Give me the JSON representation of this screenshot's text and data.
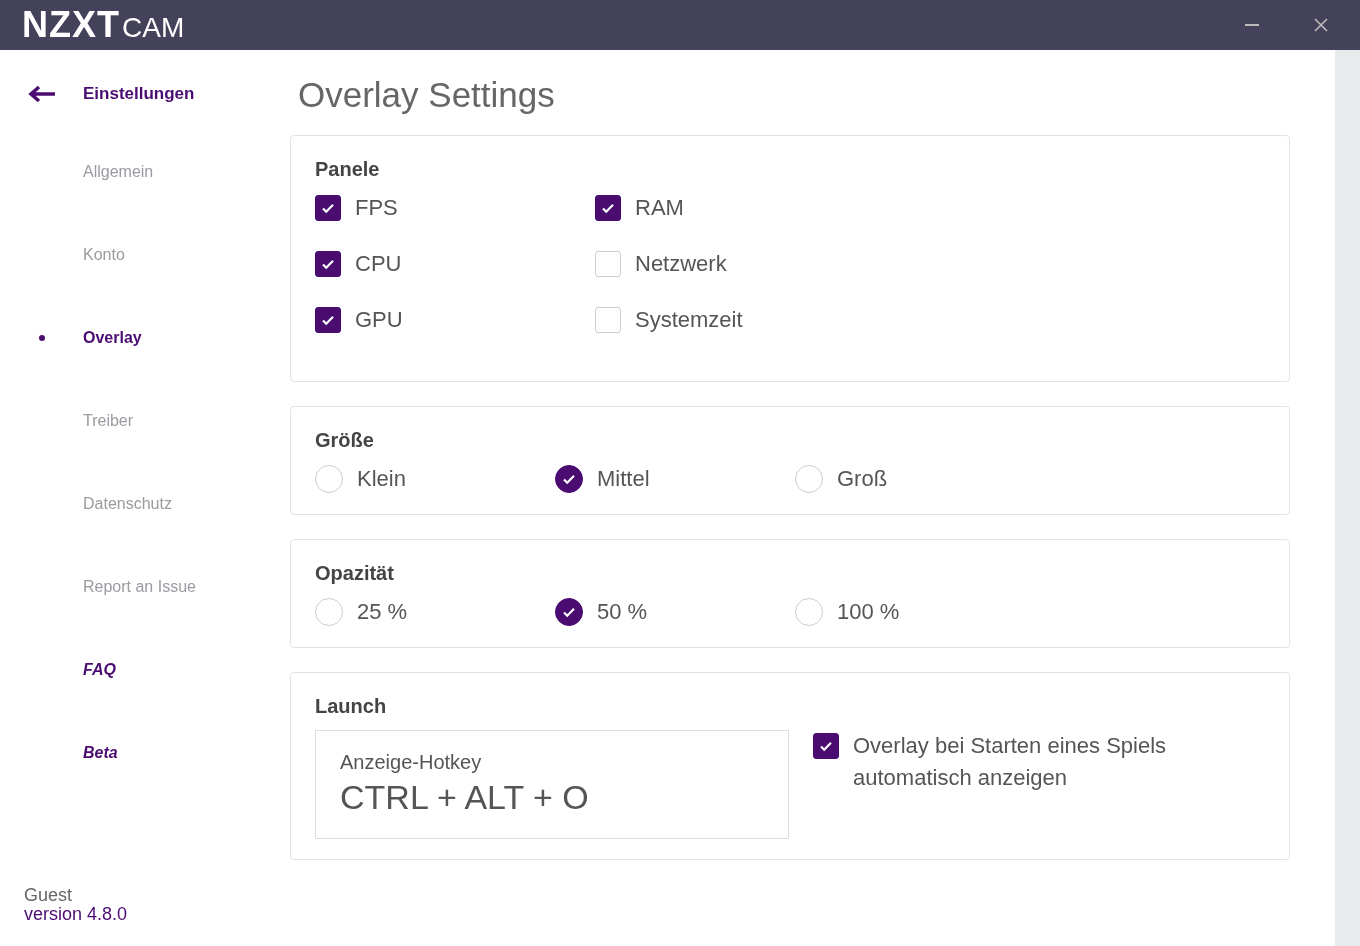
{
  "titlebar": {
    "brand": "NZXT",
    "product": "CAM"
  },
  "sidebar": {
    "back": {
      "label": "Einstellungen"
    },
    "items": [
      {
        "label": "Allgemein",
        "kind": "page",
        "selected": false
      },
      {
        "label": "Konto",
        "kind": "page",
        "selected": false
      },
      {
        "label": "Overlay",
        "kind": "page",
        "selected": true
      },
      {
        "label": "Treiber",
        "kind": "page",
        "selected": false
      },
      {
        "label": "Datenschutz",
        "kind": "page",
        "selected": false
      },
      {
        "label": "Report an Issue",
        "kind": "page",
        "selected": false
      },
      {
        "label": "FAQ",
        "kind": "extra",
        "selected": false
      },
      {
        "label": "Beta",
        "kind": "extra",
        "selected": false
      }
    ]
  },
  "footer": {
    "user": "Guest",
    "version": "version 4.8.0"
  },
  "page_title": "Overlay Settings",
  "sections": [
    {
      "title": "Panele",
      "kind": "checkboxes",
      "options": [
        {
          "label": "FPS",
          "checked": true
        },
        {
          "label": "CPU",
          "checked": true
        },
        {
          "label": "GPU",
          "checked": true
        },
        {
          "label": "RAM",
          "checked": true
        },
        {
          "label": "Netzwerk",
          "checked": false
        },
        {
          "label": "Systemzeit",
          "checked": false
        }
      ]
    },
    {
      "title": "Größe",
      "kind": "radios",
      "options": [
        {
          "label": "Klein",
          "selected": false
        },
        {
          "label": "Mittel",
          "selected": true
        },
        {
          "label": "Groß",
          "selected": false
        }
      ]
    },
    {
      "title": "Opazität",
      "kind": "radios",
      "options": [
        {
          "label": "25 %",
          "selected": false
        },
        {
          "label": "50 %",
          "selected": true
        },
        {
          "label": "100 %",
          "selected": false
        }
      ]
    },
    {
      "title": "Launch",
      "kind": "launch",
      "hotkey": {
        "label": "Anzeige-Hotkey",
        "value": "CTRL + ALT + O"
      },
      "auto_show": {
        "label": "Overlay bei Starten eines Spiels automatisch anzeigen",
        "checked": true
      }
    }
  ]
}
